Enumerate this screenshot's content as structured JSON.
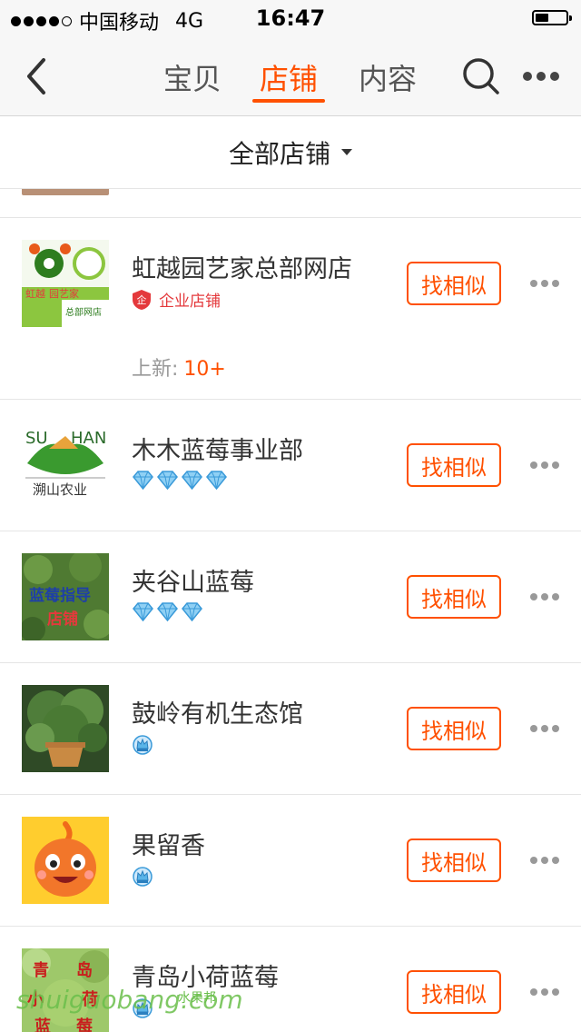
{
  "status_bar": {
    "carrier": "中国移动",
    "network": "4G",
    "time": "16:47",
    "battery_level": 0.45
  },
  "nav": {
    "tabs": [
      {
        "label": "宝贝",
        "active": false
      },
      {
        "label": "店铺",
        "active": true
      },
      {
        "label": "内容",
        "active": false
      }
    ]
  },
  "filter": {
    "label": "全部店铺"
  },
  "colors": {
    "accent": "#ff5000",
    "enterprise_red": "#e4393c",
    "diamond_blue": "#5ab4e8"
  },
  "shops": [
    {
      "name": "虹越园艺家总部网店",
      "badge_type": "enterprise",
      "badge_label": "企业店铺",
      "new_label": "上新:",
      "new_count": "10+",
      "button_label": "找相似",
      "thumb_text_lines": [
        "虹越",
        "园艺家",
        "总部网店"
      ]
    },
    {
      "name": "木木蓝莓事业部",
      "badge_type": "diamond",
      "badge_count": 4,
      "button_label": "找相似",
      "thumb_text_lines": [
        "SU",
        "HAN",
        "溯山农业"
      ]
    },
    {
      "name": "夹谷山蓝莓",
      "badge_type": "diamond",
      "badge_count": 3,
      "button_label": "找相似",
      "thumb_text_lines": [
        "蓝莓指导",
        "店铺"
      ]
    },
    {
      "name": "鼓岭有机生态馆",
      "badge_type": "crown",
      "badge_count": 1,
      "button_label": "找相似"
    },
    {
      "name": "果留香",
      "badge_type": "crown",
      "badge_count": 1,
      "button_label": "找相似"
    },
    {
      "name": "青岛小荷蓝莓",
      "badge_type": "crown",
      "badge_count": 1,
      "button_label": "找相似",
      "thumb_text_lines": [
        "青",
        "岛",
        "小",
        "荷",
        "蓝",
        "莓"
      ]
    }
  ],
  "watermark": {
    "text": "shuiguobang.com",
    "small_text": "水果邦"
  }
}
